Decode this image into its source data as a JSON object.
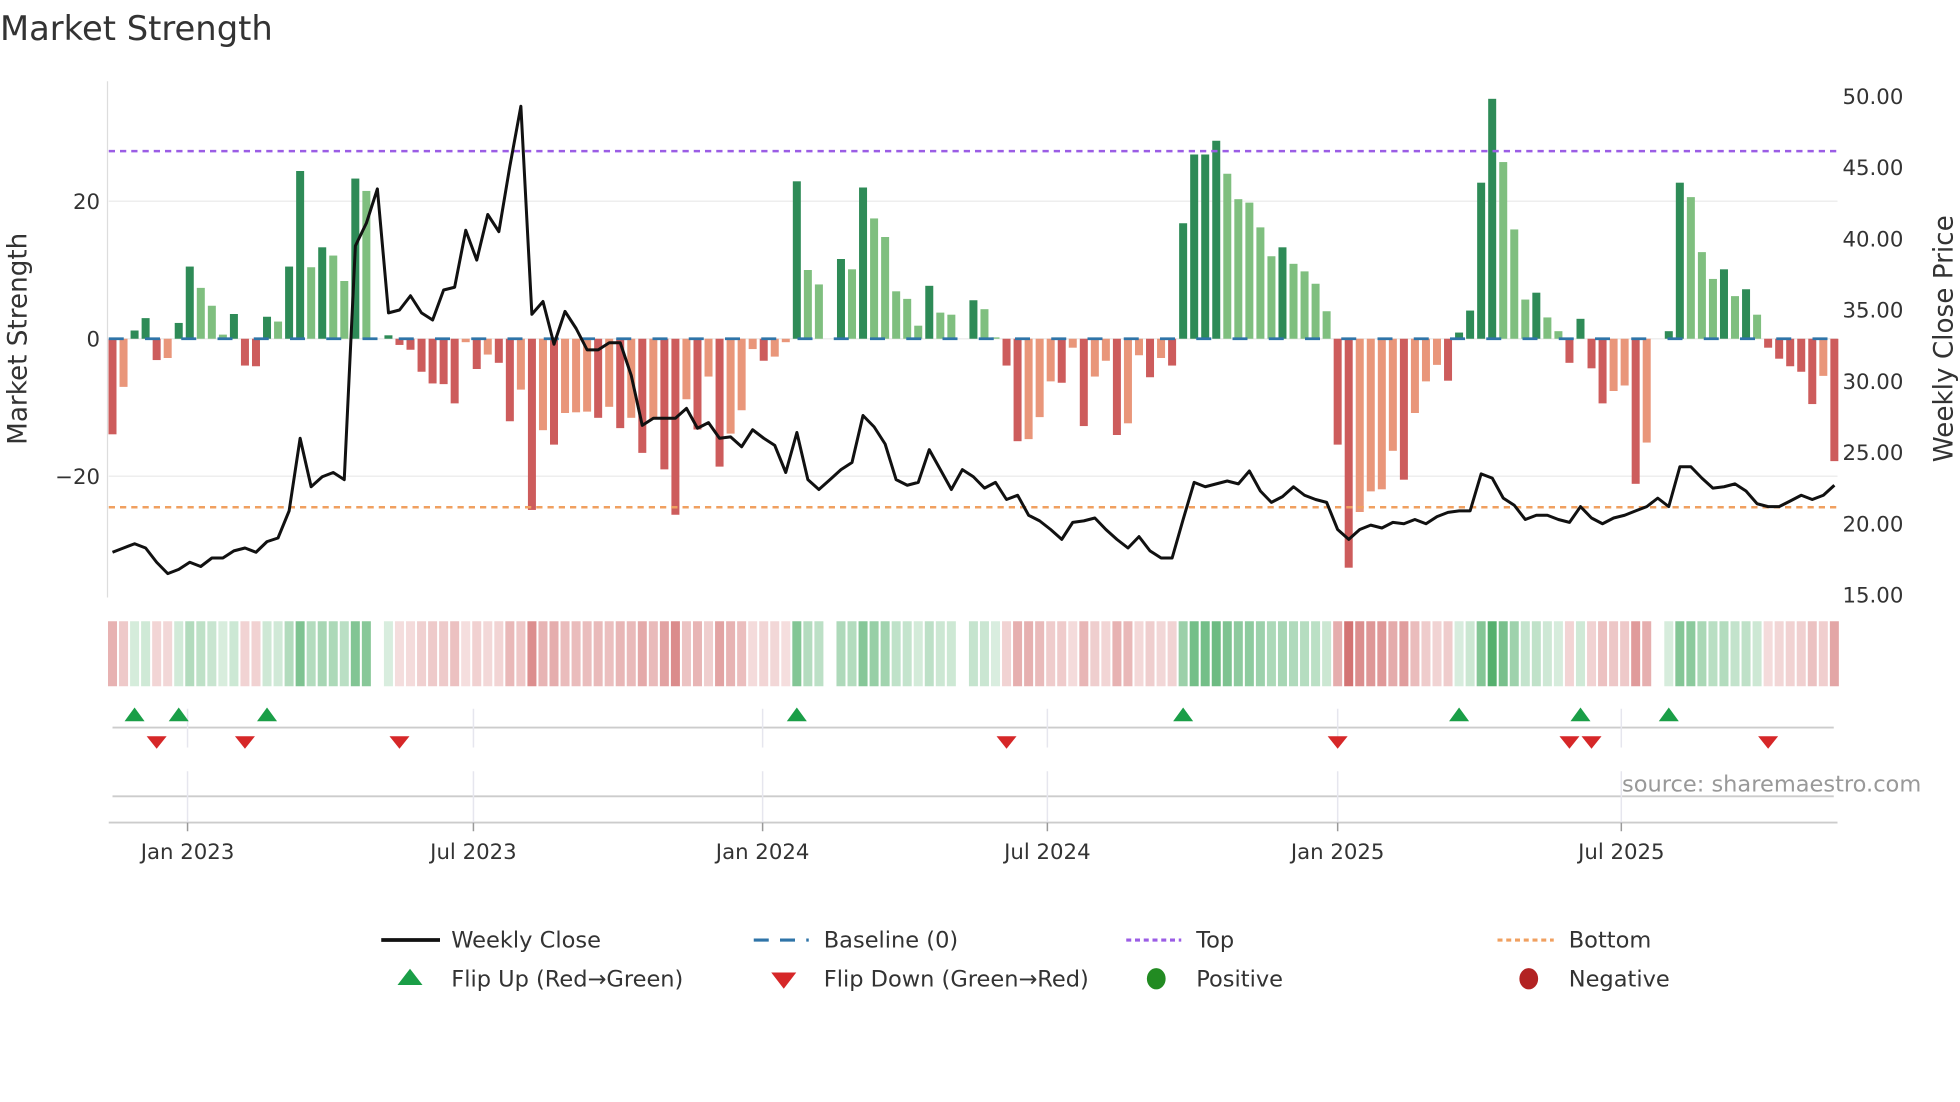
{
  "title": "Market Strength",
  "source": "source: sharemaestro.com",
  "legend": {
    "weekly_close": "Weekly Close",
    "baseline": "Baseline (0)",
    "top": "Top",
    "bottom": "Bottom",
    "flip_up": "Flip Up (Red→Green)",
    "flip_down": "Flip Down (Green→Red)",
    "positive": "Positive",
    "negative": "Negative"
  },
  "colors": {
    "pos_strong": "#2e8b57",
    "pos_weak": "#7fbf7f",
    "neg_strong": "#cd5c5c",
    "neg_weak": "#e9967a",
    "baseline": "#2f74a8",
    "top": "#9b5de5",
    "bottom": "#f0a060",
    "flip_up": "#1a9e47",
    "flip_down": "#d62728",
    "positive": "#228b22",
    "negative": "#b22222",
    "close": "#111111"
  },
  "chart_data": {
    "type": "bar+line",
    "title": "Market Strength",
    "ylabel": "Market Strength",
    "y2label": "Weekly Close Price",
    "ylim": [
      -37.5,
      37.5
    ],
    "yticks": [
      20,
      0,
      -20
    ],
    "ytick_labels": [
      "20",
      "0",
      "−20"
    ],
    "y2lim": [
      15,
      51
    ],
    "y2ticks": [
      50,
      45,
      40,
      35,
      30,
      25,
      20,
      15
    ],
    "y2tick_labels": [
      "50.00",
      "45.00",
      "40.00",
      "35.00",
      "30.00",
      "25.00",
      "20.00",
      "15.00"
    ],
    "xticks": [
      {
        "label": "Jan 2023",
        "week": 6.8
      },
      {
        "label": "Jul 2023",
        "week": 32.7
      },
      {
        "label": "Jan 2024",
        "week": 58.9
      },
      {
        "label": "Jul 2024",
        "week": 84.7
      },
      {
        "label": "Jan 2025",
        "week": 111.0
      },
      {
        "label": "Jul 2025",
        "week": 136.7
      }
    ],
    "top_level": 27.3,
    "bottom_level": -24.5,
    "baseline": 0,
    "strength": [
      -13.9,
      -7,
      1.2,
      3,
      -3.1,
      -2.8,
      2.3,
      10.5,
      7.4,
      4.8,
      0.6,
      3.6,
      -3.9,
      -4,
      3.2,
      2.5,
      10.5,
      24.4,
      10.4,
      13.3,
      12.1,
      8.4,
      23.3,
      21.5,
      0,
      0.5,
      -0.9,
      -1.6,
      -4.8,
      -6.5,
      -6.6,
      -9.4,
      -0.5,
      -4.4,
      -2.3,
      -3.5,
      -12,
      -7.4,
      -24.9,
      -13.3,
      -15.4,
      -10.8,
      -10.7,
      -10.6,
      -11.5,
      -9.9,
      -13,
      -11.5,
      -16.6,
      -11.7,
      -19,
      -25.6,
      -8.8,
      -13.2,
      -5.5,
      -18.6,
      -13.8,
      -10.4,
      -1.5,
      -3.2,
      -2.6,
      -0.5,
      22.9,
      10,
      7.9,
      0,
      11.6,
      10.1,
      22,
      17.5,
      14.8,
      6.9,
      5.8,
      1.9,
      7.7,
      3.8,
      3.5,
      0,
      5.6,
      4.3,
      0.2,
      -3.9,
      -14.9,
      -14.6,
      -11.4,
      -6.2,
      -6.4,
      -1.3,
      -12.7,
      -5.5,
      -3.2,
      -14,
      -12.3,
      -2.4,
      -5.6,
      -2.8,
      -3.9,
      16.8,
      26.8,
      26.8,
      28.8,
      24,
      20.3,
      19.8,
      16.2,
      12,
      13.3,
      10.9,
      9.8,
      8,
      4,
      -15.4,
      -33.3,
      -25.2,
      -22.2,
      -21.9,
      -16.3,
      -20.5,
      -10.8,
      -6.2,
      -3.8,
      -6.1,
      0.9,
      4.1,
      22.7,
      34.9,
      25.7,
      15.9,
      5.7,
      6.7,
      3.1,
      1.1,
      -3.5,
      2.9,
      -4.3,
      -9.4,
      -7.6,
      -6.8,
      -21.1,
      -15.1,
      0,
      1.1,
      22.7,
      20.6,
      12.6,
      8.7,
      10.1,
      6.2,
      7.2,
      3.5,
      -1.3,
      -2.9,
      -4,
      -4.8,
      -9.5,
      -5.4,
      -17.8
    ],
    "close": [
      18.0,
      18.3,
      18.6,
      18.3,
      17.3,
      16.5,
      16.8,
      17.3,
      17.0,
      17.6,
      17.6,
      18.1,
      18.3,
      18.0,
      18.75,
      19.0,
      20.9,
      26.0,
      22.6,
      23.3,
      23.6,
      23.1,
      39.5,
      41.1,
      43.5,
      34.8,
      35.0,
      36.0,
      34.8,
      34.3,
      36.4,
      36.6,
      40.6,
      38.5,
      41.7,
      40.5,
      45.1,
      49.3,
      34.7,
      35.6,
      32.6,
      34.9,
      33.7,
      32.2,
      32.2,
      32.7,
      32.7,
      30.4,
      26.9,
      27.4,
      27.4,
      27.4,
      28.1,
      26.7,
      27.1,
      26.0,
      26.1,
      25.4,
      26.6,
      26.0,
      25.5,
      23.6,
      26.4,
      23.1,
      22.4,
      23.1,
      23.8,
      24.3,
      27.6,
      26.8,
      25.6,
      23.1,
      22.7,
      22.9,
      25.2,
      23.8,
      22.4,
      23.8,
      23.3,
      22.5,
      22.9,
      21.7,
      22.0,
      20.6,
      20.2,
      19.6,
      18.9,
      20.1,
      20.2,
      20.4,
      19.6,
      18.9,
      18.3,
      19.1,
      18.1,
      17.6,
      17.6,
      20.3,
      22.9,
      22.6,
      22.8,
      23.0,
      22.8,
      23.7,
      22.3,
      21.5,
      21.9,
      22.6,
      22.0,
      21.7,
      21.5,
      19.6,
      18.9,
      19.6,
      19.9,
      19.7,
      20.1,
      20.0,
      20.3,
      20.0,
      20.5,
      20.8,
      20.9,
      20.9,
      23.5,
      23.2,
      21.8,
      21.3,
      20.3,
      20.6,
      20.6,
      20.3,
      20.1,
      21.2,
      20.4,
      20.0,
      20.4,
      20.6,
      20.9,
      21.2,
      21.8,
      21.2,
      24.0,
      24.0,
      23.2,
      22.5,
      22.6,
      22.8,
      22.3,
      21.4,
      21.2,
      21.2,
      21.6,
      22.0,
      21.7,
      22.0,
      22.7
    ],
    "flip_up_weeks": [
      2,
      6,
      14,
      62,
      97,
      122,
      133,
      141
    ],
    "flip_down_weeks": [
      4,
      12,
      26,
      81,
      111,
      132,
      134,
      150
    ],
    "grid": true,
    "legend_position": "bottom"
  }
}
